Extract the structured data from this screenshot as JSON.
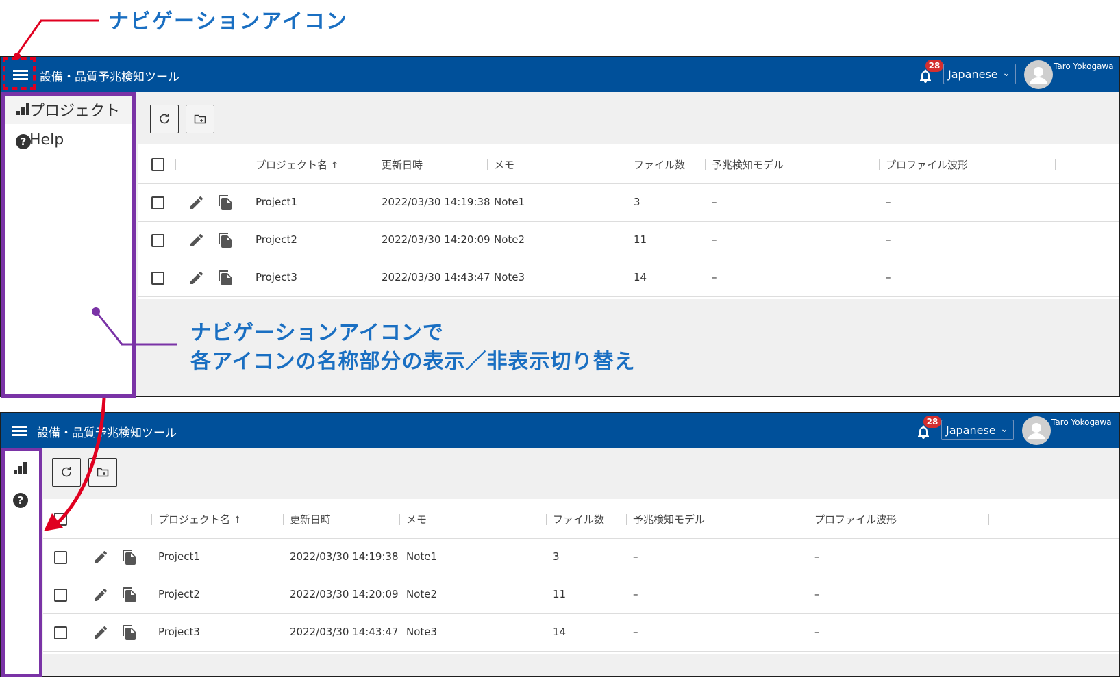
{
  "callouts": {
    "title": "ナビゲーションアイコン",
    "desc_line1": "ナビゲーションアイコンで",
    "desc_line2": "各アイコンの名称部分の表示／非表示切り替え"
  },
  "app": {
    "title": "設備・品質予兆検知ツール",
    "notification_count": "28",
    "language": "Japanese",
    "user": "Taro Yokogawa"
  },
  "sidebar": {
    "items": [
      {
        "label": "プロジェクト",
        "icon": "bar-chart-icon"
      },
      {
        "label": "Help",
        "icon": "help-icon"
      }
    ]
  },
  "toolbar": {
    "refresh_icon": "refresh-icon",
    "new_folder_icon": "new-folder-icon"
  },
  "table": {
    "columns": [
      "プロジェクト名",
      "更新日時",
      "メモ",
      "ファイル数",
      "予兆検知モデル",
      "プロファイル波形"
    ],
    "sort_indicator": "↑",
    "rows": [
      {
        "name": "Project1",
        "updated": "2022/03/30 14:19:38",
        "memo": "Note1",
        "files": "3",
        "model": "–",
        "profile": "–"
      },
      {
        "name": "Project2",
        "updated": "2022/03/30 14:20:09",
        "memo": "Note2",
        "files": "11",
        "model": "–",
        "profile": "–"
      },
      {
        "name": "Project3",
        "updated": "2022/03/30 14:43:47",
        "memo": "Note3",
        "files": "14",
        "model": "–",
        "profile": "–"
      }
    ]
  },
  "colors": {
    "header_bg": "#00509a",
    "callout_text": "#1a6fc2",
    "highlight_purple": "#7a33a6",
    "highlight_red": "#e00020",
    "badge": "#d32f2f"
  }
}
